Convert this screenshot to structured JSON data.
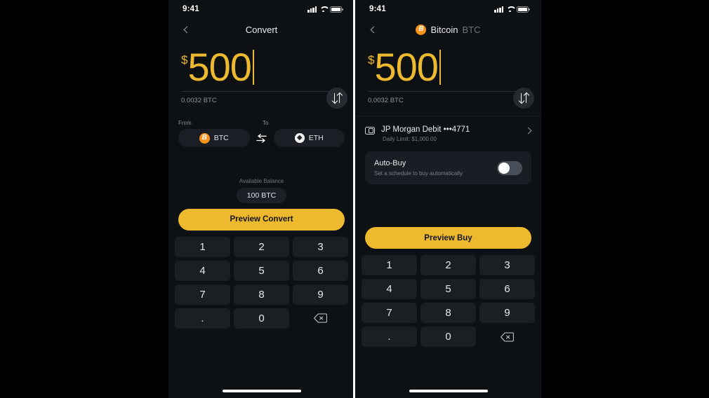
{
  "screens": [
    {
      "id": "convert",
      "status_bar": {
        "time": "9:41",
        "signal_icon": "signal-bars-icon",
        "wifi_icon": "wifi-icon",
        "battery_icon": "battery-icon"
      },
      "nav": {
        "back_icon": "chevron-left-icon",
        "title": "Convert"
      },
      "amount": {
        "currency_symbol": "$",
        "value": "500",
        "converted": "0.0032 BTC",
        "swap_icon": "swap-vertical-icon"
      },
      "convert": {
        "from_label": "From",
        "to_label": "To",
        "from_pill": {
          "symbol": "BTC",
          "coin_icon": "bitcoin-coin-icon"
        },
        "to_pill": {
          "symbol": "ETH",
          "coin_icon": "ethereum-coin-icon"
        },
        "swap_icon": "swap-horizontal-icon"
      },
      "balance": {
        "label": "Available Balance",
        "value": "100 BTC"
      },
      "cta": {
        "label": "Preview Convert"
      },
      "keypad": {
        "keys": [
          "1",
          "2",
          "3",
          "4",
          "5",
          "6",
          "7",
          "8",
          "9",
          ".",
          "0"
        ],
        "backspace_icon": "backspace-delete-icon"
      }
    },
    {
      "id": "buy",
      "status_bar": {
        "time": "9:41",
        "signal_icon": "signal-bars-icon",
        "wifi_icon": "wifi-icon",
        "battery_icon": "battery-icon"
      },
      "nav": {
        "back_icon": "chevron-left-icon",
        "title": "Bitcoin",
        "symbol": "BTC",
        "coin_icon": "bitcoin-coin-icon"
      },
      "amount": {
        "currency_symbol": "$",
        "value": "500",
        "converted": "0.0032 BTC",
        "swap_icon": "swap-vertical-icon"
      },
      "payment": {
        "card_icon": "credit-card-icon",
        "title": "JP Morgan Debit •••4771",
        "subtitle": "Daily Limit: $1,000.00",
        "chevron_icon": "chevron-right-icon"
      },
      "auto_buy": {
        "title": "Auto-Buy",
        "subtitle": "Set a schedule to buy automatically",
        "toggle_state": "off"
      },
      "cta": {
        "label": "Preview Buy"
      },
      "keypad": {
        "keys": [
          "1",
          "2",
          "3",
          "4",
          "5",
          "6",
          "7",
          "8",
          "9",
          ".",
          "0"
        ],
        "backspace_icon": "backspace-delete-icon"
      }
    }
  ],
  "theme": {
    "background": "#000000",
    "panel": "#0E1114",
    "accent_yellow": "#EDB92E",
    "bitcoin_orange": "#F7931A",
    "key_bg": "#1B1E23",
    "text_primary": "#E9EAEC",
    "text_muted": "#7B818A"
  }
}
